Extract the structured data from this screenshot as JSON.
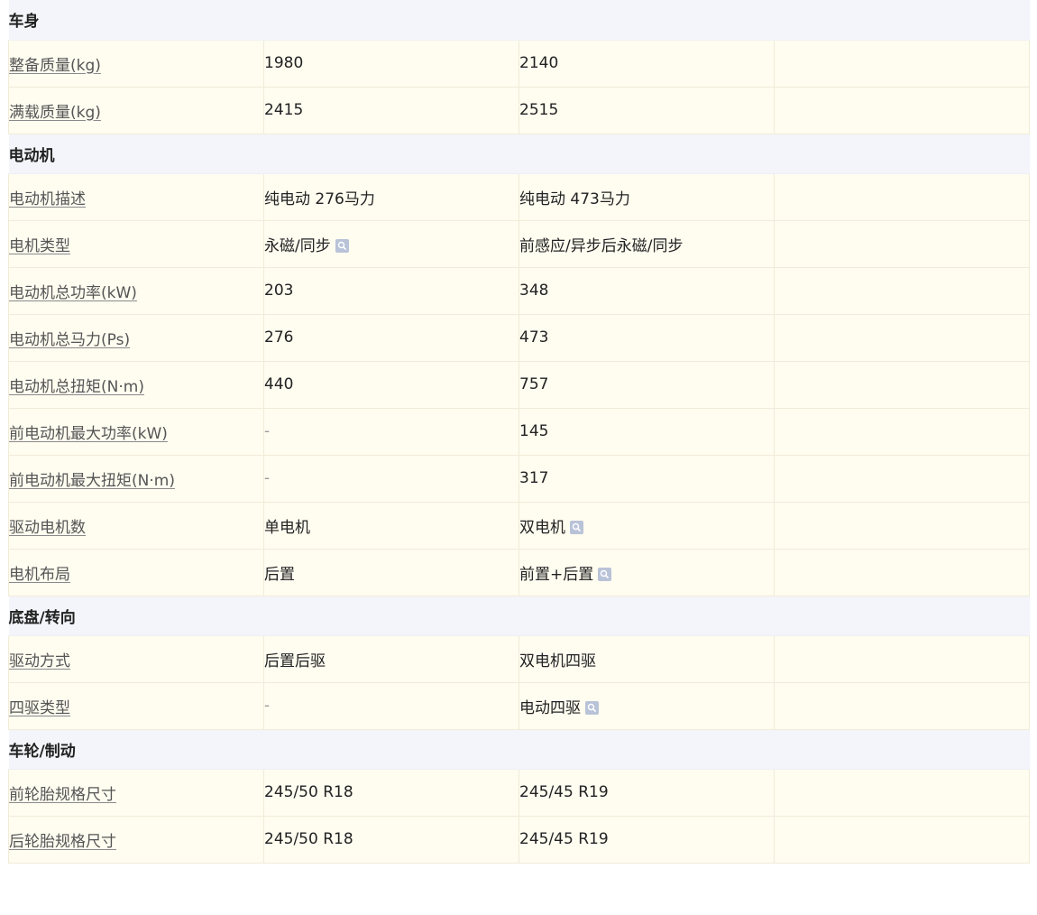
{
  "sections": [
    {
      "title": "车身",
      "rows": [
        {
          "label": "整备质量(kg)",
          "v1": "1980",
          "v2": "2140",
          "v3": ""
        },
        {
          "label": "满载质量(kg)",
          "v1": "2415",
          "v2": "2515",
          "v3": ""
        }
      ]
    },
    {
      "title": "电动机",
      "rows": [
        {
          "label": "电动机描述",
          "v1": "纯电动 276马力",
          "v2": "纯电动 473马力",
          "v3": ""
        },
        {
          "label": "电机类型",
          "v1": "永磁/同步",
          "v1_icon": "info-search-icon",
          "v2": "前感应/异步后永磁/同步",
          "v3": ""
        },
        {
          "label": "电动机总功率(kW)",
          "v1": "203",
          "v2": "348",
          "v3": ""
        },
        {
          "label": "电动机总马力(Ps)",
          "v1": "276",
          "v2": "473",
          "v3": ""
        },
        {
          "label": "电动机总扭矩(N·m)",
          "v1": "440",
          "v2": "757",
          "v3": ""
        },
        {
          "label": "前电动机最大功率(kW)",
          "v1": "-",
          "v2": "145",
          "v3": ""
        },
        {
          "label": "前电动机最大扭矩(N·m)",
          "v1": "-",
          "v2": "317",
          "v3": ""
        },
        {
          "label": "驱动电机数",
          "v1": "单电机",
          "v2": "双电机",
          "v2_icon": "info-search-icon",
          "v3": ""
        },
        {
          "label": "电机布局",
          "v1": "后置",
          "v2": "前置+后置",
          "v2_icon": "info-search-icon",
          "v3": ""
        }
      ]
    },
    {
      "title": "底盘/转向",
      "rows": [
        {
          "label": "驱动方式",
          "v1": "后置后驱",
          "v2": "双电机四驱",
          "v3": ""
        },
        {
          "label": "四驱类型",
          "v1": "-",
          "v2": "电动四驱",
          "v2_icon": "info-search-icon",
          "v3": ""
        }
      ]
    },
    {
      "title": "车轮/制动",
      "rows": [
        {
          "label": "前轮胎规格尺寸",
          "v1": "245/50 R18",
          "v2": "245/45 R19",
          "v3": ""
        },
        {
          "label": "后轮胎规格尺寸",
          "v1": "245/50 R18",
          "v2": "245/45 R19",
          "v3": ""
        }
      ]
    }
  ],
  "colors": {
    "section_bg": "#f4f5fa",
    "row_bg": "#fffcf0",
    "border": "#f1ecd8",
    "icon": "#b9c3d8"
  }
}
